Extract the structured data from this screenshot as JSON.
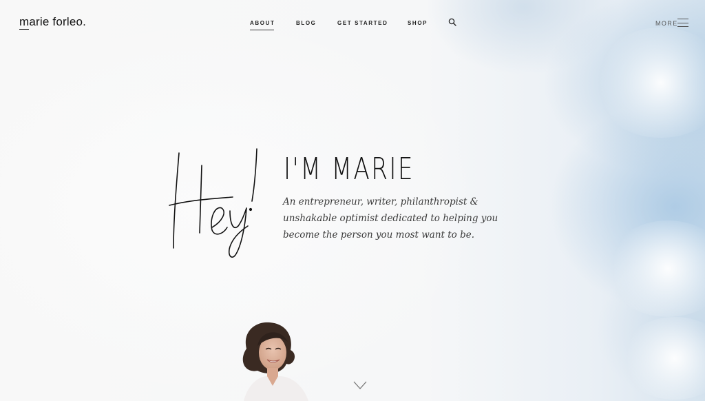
{
  "header": {
    "logo": "marie forleo.",
    "nav": [
      {
        "label": "ABOUT",
        "active": true
      },
      {
        "label": "BLOG",
        "active": false
      },
      {
        "label": "GET STARTED",
        "active": false
      },
      {
        "label": "SHOP",
        "active": false
      }
    ],
    "search_icon": "search-icon",
    "more_label": "MORE",
    "menu_icon": "hamburger-menu-icon"
  },
  "hero": {
    "script_word": "Hey!",
    "title": "I'M MARIE",
    "subtitle": "An entrepreneur, writer, philanthropist & unshakable optimist dedicated to helping you become the person you most want to be."
  },
  "scroll": {
    "icon": "chevron-down-icon"
  },
  "colors": {
    "text": "#1c1c1c",
    "sky_accent": "#cfe0ee"
  }
}
